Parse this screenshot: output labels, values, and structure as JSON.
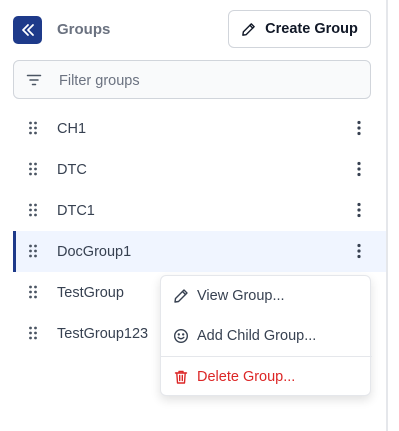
{
  "panel": {
    "title": "Groups"
  },
  "toolbar": {
    "create_label": "Create Group"
  },
  "filter": {
    "placeholder": "Filter groups",
    "value": ""
  },
  "groups": [
    {
      "name": "CH1",
      "selected": false
    },
    {
      "name": "DTC",
      "selected": false
    },
    {
      "name": "DTC1",
      "selected": false
    },
    {
      "name": "DocGroup1",
      "selected": true
    },
    {
      "name": "TestGroup",
      "selected": false
    },
    {
      "name": "TestGroup123",
      "selected": false
    }
  ],
  "context_menu": {
    "items": [
      {
        "label": "View Group...",
        "icon": "pencil-icon"
      },
      {
        "label": "Add Child Group...",
        "icon": "smiley-icon"
      },
      {
        "label": "Delete Group...",
        "icon": "trash-icon",
        "danger": true
      }
    ]
  },
  "colors": {
    "accent": "#1e3a8a",
    "danger": "#dc2626",
    "selected_row": "#f0f5ff"
  }
}
